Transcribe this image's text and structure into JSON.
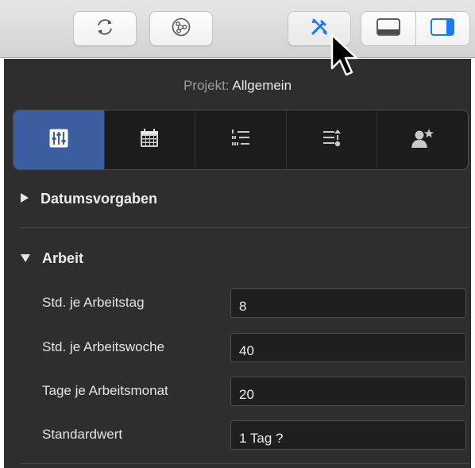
{
  "toolbar": {
    "buttons": [
      {
        "name": "refresh-icon"
      },
      {
        "name": "compass-icon"
      },
      {
        "name": "tools-icon"
      }
    ],
    "view_segments": [
      {
        "name": "bottom-panel-icon",
        "selected": false
      },
      {
        "name": "right-sidebar-icon",
        "selected": true
      }
    ],
    "accent_color": "#1a7cf5"
  },
  "inspector": {
    "context_prefix": "Projekt:",
    "context_value": "Allgemein",
    "tabs": [
      {
        "name": "sliders-icon",
        "active": true
      },
      {
        "name": "calendar-icon",
        "active": false
      },
      {
        "name": "list-icon",
        "active": false
      },
      {
        "name": "sort-list-icon",
        "active": false
      },
      {
        "name": "person-star-icon",
        "active": false
      }
    ],
    "active_tab_color": "#3b5ea1",
    "sections": {
      "date_defaults": {
        "title": "Datumsvorgaben",
        "expanded": false
      },
      "work": {
        "title": "Arbeit",
        "expanded": true,
        "rows": [
          {
            "label": "Std. je Arbeitstag",
            "value": "8"
          },
          {
            "label": "Std. je Arbeitswoche",
            "value": "40"
          },
          {
            "label": "Tage je Arbeitsmonat",
            "value": "20"
          },
          {
            "label": "Standardwert",
            "value": "1 Tag ?"
          }
        ]
      }
    }
  }
}
